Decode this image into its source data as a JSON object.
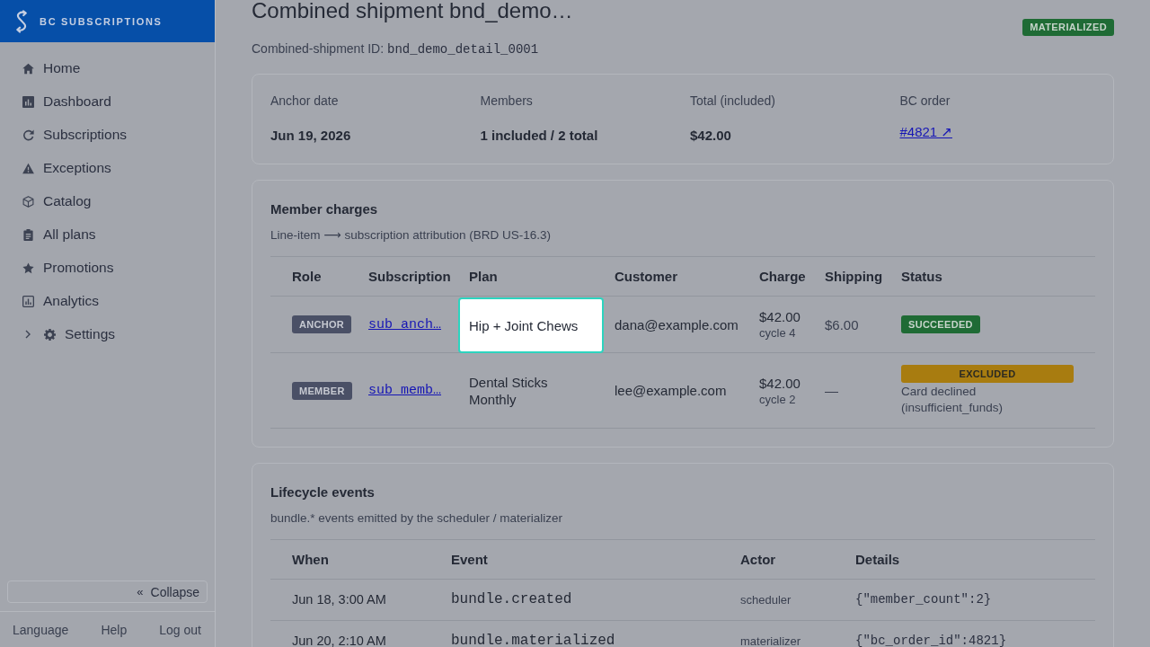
{
  "sidebar": {
    "brand": "BC SUBSCRIPTIONS",
    "items": [
      {
        "label": "Home",
        "kind": "link"
      },
      {
        "label": "Dashboard",
        "kind": "link"
      },
      {
        "label": "Subscriptions",
        "kind": "link"
      },
      {
        "label": "Exceptions",
        "kind": "link"
      },
      {
        "label": "Catalog",
        "kind": "link"
      },
      {
        "label": "All plans",
        "kind": "link"
      },
      {
        "label": "Promotions",
        "kind": "link"
      },
      {
        "label": "Analytics",
        "kind": "link"
      },
      {
        "label": "Settings",
        "kind": "group",
        "expanded": false
      }
    ],
    "collapse_button": {
      "glyph": "«",
      "label": "Collapse"
    },
    "footer_links": [
      "Language",
      "Help",
      "Log out"
    ]
  },
  "header": {
    "title": "Combined shipment bnd_demo…",
    "status_badge": "MATERIALIZED",
    "id_label": "Combined-shipment ID:",
    "id_value": "bnd_demo_detail_0001"
  },
  "summary": [
    {
      "label": "Anchor date",
      "value": "Jun 19, 2026",
      "kind": "text"
    },
    {
      "label": "Members",
      "value": "1 included / 2 total",
      "kind": "text"
    },
    {
      "label": "Total (included)",
      "value": "$42.00",
      "kind": "text"
    },
    {
      "label": "BC order",
      "value": "#4821 ↗",
      "kind": "link"
    }
  ],
  "member_charges": {
    "title": "Member charges",
    "subtitle": "Line-item ⟶ subscription attribution (BRD US-16.3)",
    "columns": [
      "Role",
      "Subscription",
      "Plan",
      "Customer",
      "Charge",
      "Shipping",
      "Status"
    ],
    "rows": [
      {
        "role": "ANCHOR",
        "subscription": "sub_anch…",
        "plan": "Hip + Joint Chews",
        "plan_highlighted": true,
        "customer": "dana@example.com",
        "charge": "$42.00",
        "cycle": "cycle 4",
        "shipping": "$6.00",
        "status": {
          "label": "SUCCEEDED",
          "kind": "succeeded"
        }
      },
      {
        "role": "MEMBER",
        "subscription": "sub_memb…",
        "plan": "Dental Sticks Monthly",
        "plan_highlighted": false,
        "customer": "lee@example.com",
        "charge": "$42.00",
        "cycle": "cycle 2",
        "shipping": "—",
        "status": {
          "label": "EXCLUDED",
          "kind": "excluded",
          "note": "Card declined (insufficient_funds)"
        }
      }
    ]
  },
  "lifecycle_events": {
    "title": "Lifecycle events",
    "subtitle": "bundle.* events emitted by the scheduler / materializer",
    "columns": [
      "When",
      "Event",
      "Actor",
      "Details"
    ],
    "rows": [
      {
        "when": "Jun 18, 3:00 AM",
        "event": "bundle.created",
        "actor": "scheduler",
        "details": "{\"member_count\":2}"
      },
      {
        "when": "Jun 20, 2:10 AM",
        "event": "bundle.materialized",
        "actor": "materializer",
        "details": "{\"bc_order_id\":4821}"
      }
    ]
  }
}
